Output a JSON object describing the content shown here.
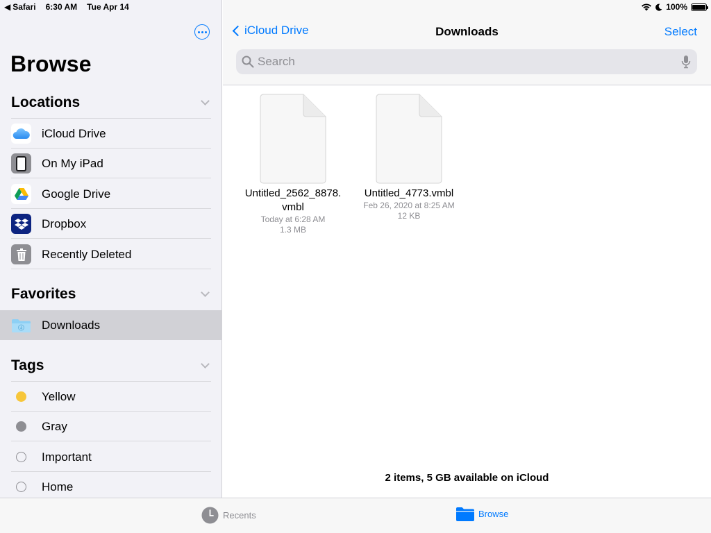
{
  "status_bar": {
    "back_app": "Safari",
    "time": "6:30 AM",
    "date": "Tue Apr 14",
    "battery": "100%"
  },
  "sidebar": {
    "title": "Browse",
    "locations": {
      "heading": "Locations",
      "items": [
        {
          "label": "iCloud Drive",
          "icon": "icloud-icon"
        },
        {
          "label": "On My iPad",
          "icon": "ipad-icon"
        },
        {
          "label": "Google Drive",
          "icon": "google-drive-icon"
        },
        {
          "label": "Dropbox",
          "icon": "dropbox-icon"
        },
        {
          "label": "Recently Deleted",
          "icon": "trash-icon"
        }
      ]
    },
    "favorites": {
      "heading": "Favorites",
      "items": [
        {
          "label": "Downloads",
          "icon": "downloads-folder-icon",
          "selected": true
        }
      ]
    },
    "tags": {
      "heading": "Tags",
      "items": [
        {
          "label": "Yellow",
          "color": "#f7c63a"
        },
        {
          "label": "Gray",
          "color": "#8e8e93"
        },
        {
          "label": "Important",
          "color": "none"
        },
        {
          "label": "Home",
          "color": "none"
        }
      ]
    }
  },
  "main": {
    "back_label": "iCloud Drive",
    "title": "Downloads",
    "select_label": "Select",
    "search_placeholder": "Search",
    "files": [
      {
        "name_line1": "Untitled_2562_8878.",
        "name_line2": "vmbl",
        "date": "Today at 6:28 AM",
        "size": "1.3 MB"
      },
      {
        "name_line1": "Untitled_4773.vmbl",
        "name_line2": "",
        "date": "Feb 26, 2020 at 8:25 AM",
        "size": "12 KB"
      }
    ],
    "summary": "2 items, 5 GB available on iCloud"
  },
  "tab_bar": {
    "recents": "Recents",
    "browse": "Browse"
  },
  "colors": {
    "accent": "#007aff",
    "yellow_tag": "#f7c63a",
    "gray_tag": "#8e8e93"
  }
}
